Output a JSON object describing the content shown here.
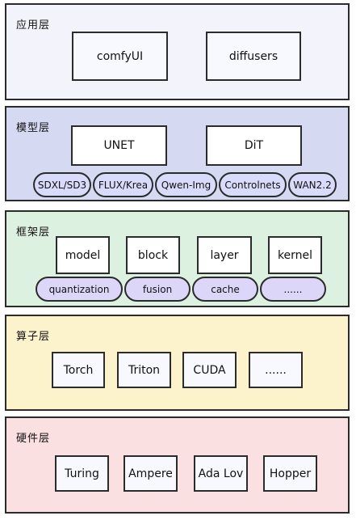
{
  "layers": {
    "app": {
      "title": "应用层",
      "items": [
        "comfyUI",
        "diffusers"
      ]
    },
    "model": {
      "title": "模型层",
      "items": [
        "UNET",
        "DiT"
      ],
      "tags": [
        "SDXL/SD3",
        "FLUX/Krea",
        "Qwen-Img",
        "Controlnets",
        "WAN2.2"
      ]
    },
    "framework": {
      "title": "框架层",
      "items": [
        "model",
        "block",
        "layer",
        "kernel"
      ],
      "tags": [
        "quantization",
        "fusion",
        "cache",
        "......"
      ]
    },
    "operator": {
      "title": "算子层",
      "items": [
        "Torch",
        "Triton",
        "CUDA",
        "......"
      ]
    },
    "hardware": {
      "title": "硬件层",
      "items": [
        "Turing",
        "Ampere",
        "Ada Lov",
        "Hopper"
      ]
    }
  },
  "colors": {
    "app_bg": "#f3f4fb",
    "model_bg": "#d5d9f2",
    "framework_bg": "#dcf1df",
    "operator_bg": "#fcf2cc",
    "hardware_bg": "#fbe0e1",
    "model_tag_bg": "#d9dbfb",
    "framework_tag_bg": "#dcd6f8",
    "border": "#2b2b2b"
  }
}
